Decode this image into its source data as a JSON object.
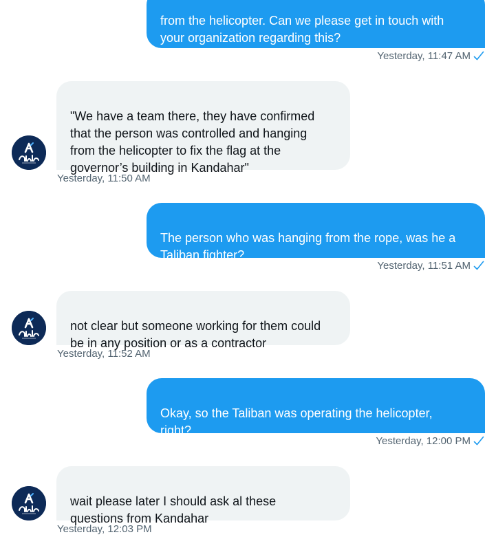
{
  "conversation": {
    "messages": [
      {
        "direction": "outgoing",
        "text": "from the helicopter. Can we please get in touch with\nyour organization regarding this?",
        "timestamp": "Yesterday, 11:47 AM",
        "read": true
      },
      {
        "direction": "incoming",
        "text": "\"We have a team there, they have confirmed\nthat the person was controlled and hanging\nfrom the helicopter to fix the flag at the\ngovernor’s building in Kandahar\"",
        "timestamp": "Yesterday, 11:50 AM"
      },
      {
        "direction": "outgoing",
        "text": "The person who was hanging from the rope, was he a\nTaliban fighter?",
        "timestamp": "Yesterday, 11:51 AM",
        "read": true
      },
      {
        "direction": "incoming",
        "text": "not clear but someone working for them could\nbe in any position or as a contractor",
        "timestamp": "Yesterday, 11:52 AM"
      },
      {
        "direction": "outgoing",
        "text": "Okay, so the Taliban was operating the helicopter,\nright?",
        "timestamp": "Yesterday, 12:00 PM",
        "read": true
      },
      {
        "direction": "incoming",
        "text": "wait please later I should ask al these\nquestions from Kandahar",
        "timestamp": "Yesterday, 12:03 PM"
      }
    ],
    "contact_avatar": {
      "logo_text": "آسواکا",
      "icon": "aswaka-logo-icon"
    },
    "read_receipt_icon": "checkmark-icon"
  },
  "colors": {
    "outgoing_bubble": "#1d9bf0",
    "incoming_bubble": "#eff3f4",
    "timestamp_text": "#536471",
    "avatar_background": "#0d2a57"
  }
}
